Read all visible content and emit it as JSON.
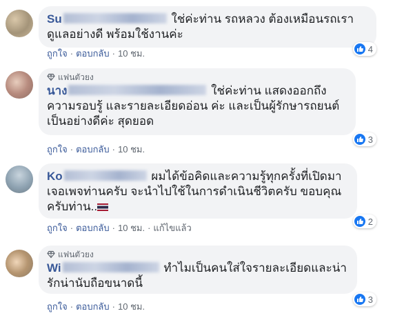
{
  "comments": [
    {
      "badge": "",
      "name": "Su",
      "text": " ใช่ค่ะท่าน รถหลวง ต้องเหมือนรถเรา ดูแลอย่างดี พร้อมใช้งานค่ะ",
      "like": "ถูกใจ",
      "reply": "ตอบกลับ",
      "time": "10 ชม.",
      "edited": "",
      "count": "4"
    },
    {
      "badge": "แฟนตัวยง",
      "name": "นาง",
      "text": " ใช่ค่ะท่าน แสดงออกถึงความรอบรู้ และรายละเอียดอ่อน ค่ะ และเป็นผู้รักษารถยนต์ เป็นอย่างดีค่ะ สุดยอด",
      "like": "ถูกใจ",
      "reply": "ตอบกลับ",
      "time": "10 ชม.",
      "edited": "",
      "count": "3"
    },
    {
      "badge": "",
      "name": "Ko",
      "text": " ผมได้ข้อคิดและความรู้ทุกครั้งที่เปิดมาเจอเพจท่านครับ จะนำไปใช้ในการดำเนินชีวิตครับ ขอบคุณครับท่าน..",
      "like": "ถูกใจ",
      "reply": "ตอบกลับ",
      "time": "10 ชม.",
      "edited": "แก้ไขแล้ว",
      "count": "2"
    },
    {
      "badge": "แฟนตัวยง",
      "name": "Wi",
      "text": " ทำไมเป็นคนใส่ใจรายละเอียดและน่ารักน่านับถือขนาดนี้",
      "like": "ถูกใจ",
      "reply": "ตอบกลับ",
      "time": "10 ชม.",
      "edited": "",
      "count": "3"
    }
  ],
  "colors": {
    "link": "#385898",
    "bubble": "#f2f3f5",
    "like": "#1877f2"
  }
}
